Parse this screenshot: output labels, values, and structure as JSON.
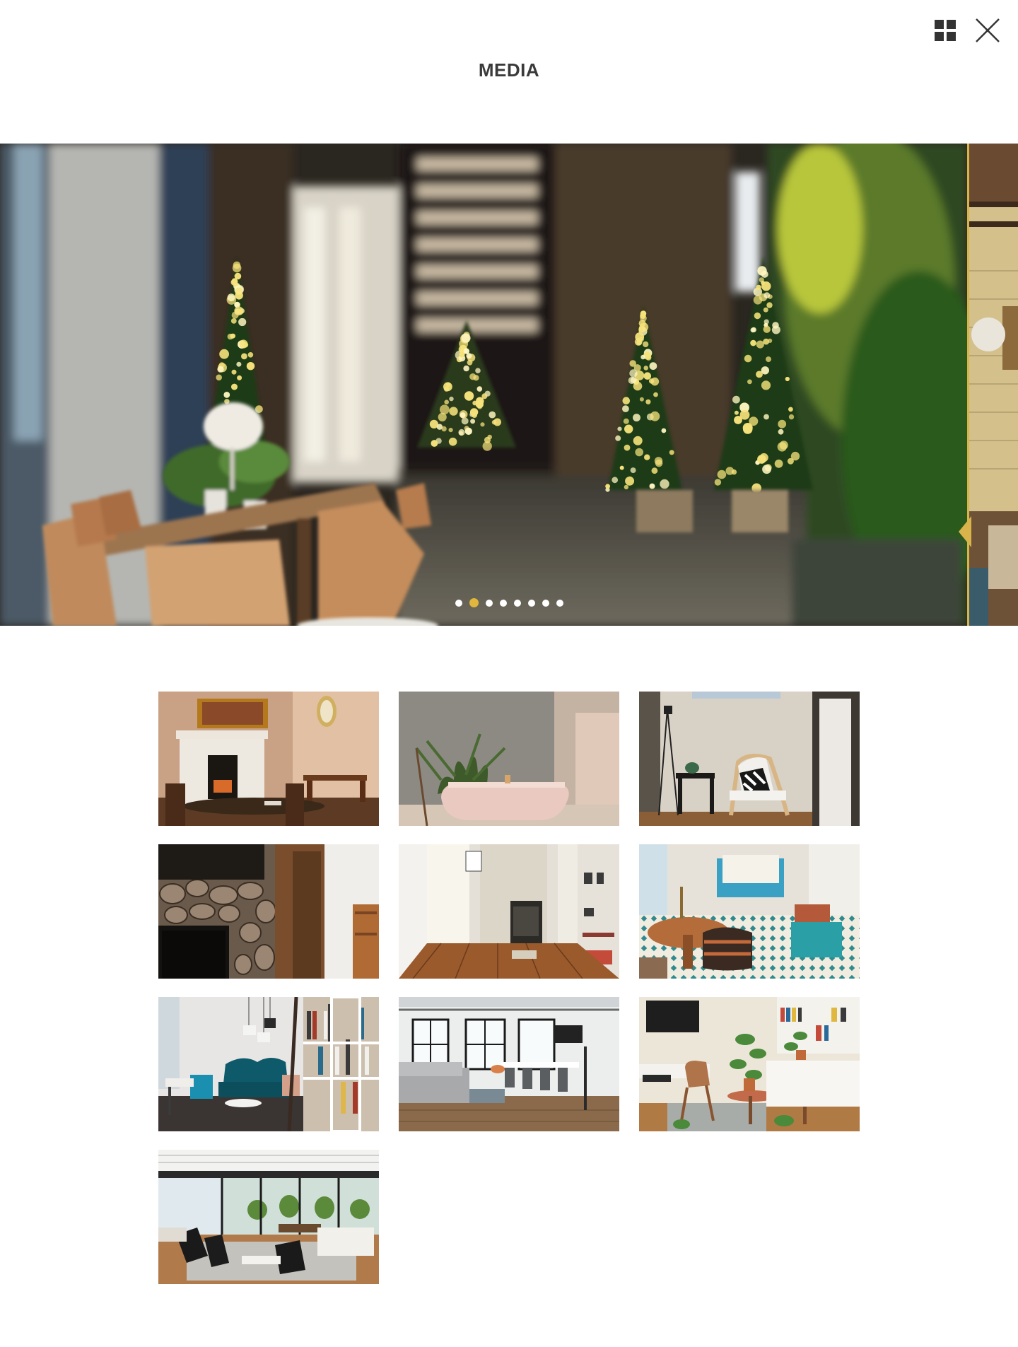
{
  "header": {
    "title": "MEDIA",
    "grid_view_icon": "grid-icon",
    "close_icon": "close-icon"
  },
  "carousel": {
    "slide_count": 8,
    "active_index": 1,
    "next_arrow_icon": "chevron-left-icon"
  },
  "thumbnails": [
    {
      "scene": "fireplace-dining-room"
    },
    {
      "scene": "bathroom-tub"
    },
    {
      "scene": "reading-nook-chair"
    },
    {
      "scene": "stone-fireplace-kitchen"
    },
    {
      "scene": "empty-hallway-wood-floor"
    },
    {
      "scene": "tiled-floor-living-room"
    },
    {
      "scene": "library-lounge"
    },
    {
      "scene": "loft-open-plan"
    },
    {
      "scene": "plants-living-room"
    },
    {
      "scene": "glass-wall-living-room"
    }
  ],
  "colors": {
    "accent": "#e0b63c",
    "title": "#3a3a3a"
  }
}
